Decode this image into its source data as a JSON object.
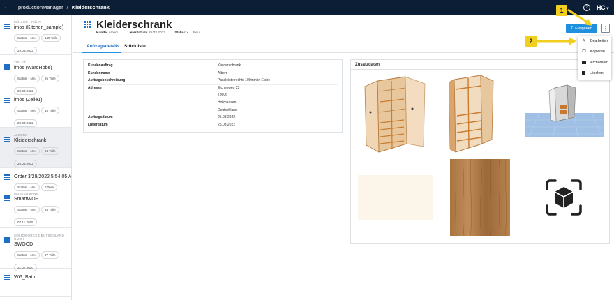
{
  "topbar": {
    "app_name": "productionManager",
    "separator": "/",
    "current_page": "Kleiderschrank",
    "help_label": "?",
    "logo_text": "HC"
  },
  "sidebar": {
    "cards": [
      {
        "customer": "MÜLLER - KÜHN",
        "title": "imos (Kitchen_sample)",
        "status_label": "Status:",
        "status": "Neu",
        "parts": "149 Teile",
        "date": "29.03.2022",
        "selected": false
      },
      {
        "customer": "TISLEZ",
        "title": "imos (WardRobe)",
        "status_label": "Status:",
        "status": "Neu",
        "parts": "65 Teile",
        "date": "29.03.2022",
        "selected": false
      },
      {
        "customer": "",
        "title": "imos (Zelle1)",
        "status_label": "Status:",
        "status": "Neu",
        "parts": "15 Teile",
        "date": "29.03.2022",
        "selected": false
      },
      {
        "customer": "ALBERS",
        "title": "Kleiderschrank",
        "status_label": "Status:",
        "status": "Neu",
        "parts": "24 Teile",
        "date": "25.03.2022",
        "selected": true
      },
      {
        "customer": "",
        "title": "Order 3/29/2022 5:54:05 AM",
        "status_label": "Status:",
        "status": "Neu",
        "parts": "0 Teile",
        "date": "",
        "selected": false
      },
      {
        "customer": "MUSTERMANN",
        "title": "SmartWOP",
        "status_label": "Status:",
        "status": "Neu",
        "parts": "54 Teile",
        "date": "07.11.2019",
        "selected": false
      },
      {
        "customer": "SOLIDWORKS DEUTSCHLAND GMBH",
        "title": "SWOOD",
        "status_label": "Status:",
        "status": "Neu",
        "parts": "87 Teile",
        "date": "31.07.2020",
        "selected": false
      },
      {
        "customer": "",
        "title": "WG_Bath",
        "status_label": "",
        "status": "",
        "parts": "",
        "date": "",
        "selected": false
      }
    ]
  },
  "header": {
    "title": "Kleiderschrank",
    "meta": {
      "customer_label": "Kunde:",
      "customer": "Albers",
      "delivery_label": "Lieferdatum:",
      "delivery": "25.03.2022",
      "status_label": "Status:",
      "status": "Neu"
    },
    "release_label": "Freigeben",
    "more_label": "⋮"
  },
  "dropdown": {
    "items": [
      {
        "label": "Bearbeiten",
        "icon": "pencil-icon"
      },
      {
        "label": "Kopieren",
        "icon": "copy-icon"
      },
      {
        "label": "Archivieren",
        "icon": "archive-icon"
      },
      {
        "label": "Löschen",
        "icon": "trash-icon"
      }
    ]
  },
  "tabs": [
    {
      "label": "Auftragsdetails",
      "active": true
    },
    {
      "label": "Stückliste",
      "active": false
    }
  ],
  "details": {
    "rows": [
      {
        "label": "Kundenauftrag",
        "value": "Kleiderschrank"
      },
      {
        "label": "Kundenname",
        "value": "Albers"
      },
      {
        "label": "Auftragsbeschreibung",
        "value": "Passleiste rechts 100mm in Eiche"
      },
      {
        "label": "Adresse",
        "value": "Eichenweg 23"
      },
      {
        "label": "",
        "value": "78606"
      },
      {
        "label": "",
        "value": "Holzhausen"
      },
      {
        "label": "",
        "value": "Deutschland"
      },
      {
        "label": "Auftragsdatum",
        "value": "25.03.2022"
      },
      {
        "label": "Lieferdatum",
        "value": "25.03.2022"
      }
    ]
  },
  "extra": {
    "title": "Zusatzdaten",
    "thumbnails": [
      {
        "name": "wardrobe-open-render"
      },
      {
        "name": "wardrobe-frame-render"
      },
      {
        "name": "wardrobe-3d-scene"
      },
      {
        "name": "cream-material-swatch"
      },
      {
        "name": "oak-wood-material-swatch"
      },
      {
        "name": "ar-cube-icon"
      }
    ]
  },
  "callouts": {
    "one": "1",
    "two": "2"
  },
  "colors": {
    "topbar": "#0c1e35",
    "accent": "#1f8fe0",
    "callout": "#f2cf1f"
  }
}
